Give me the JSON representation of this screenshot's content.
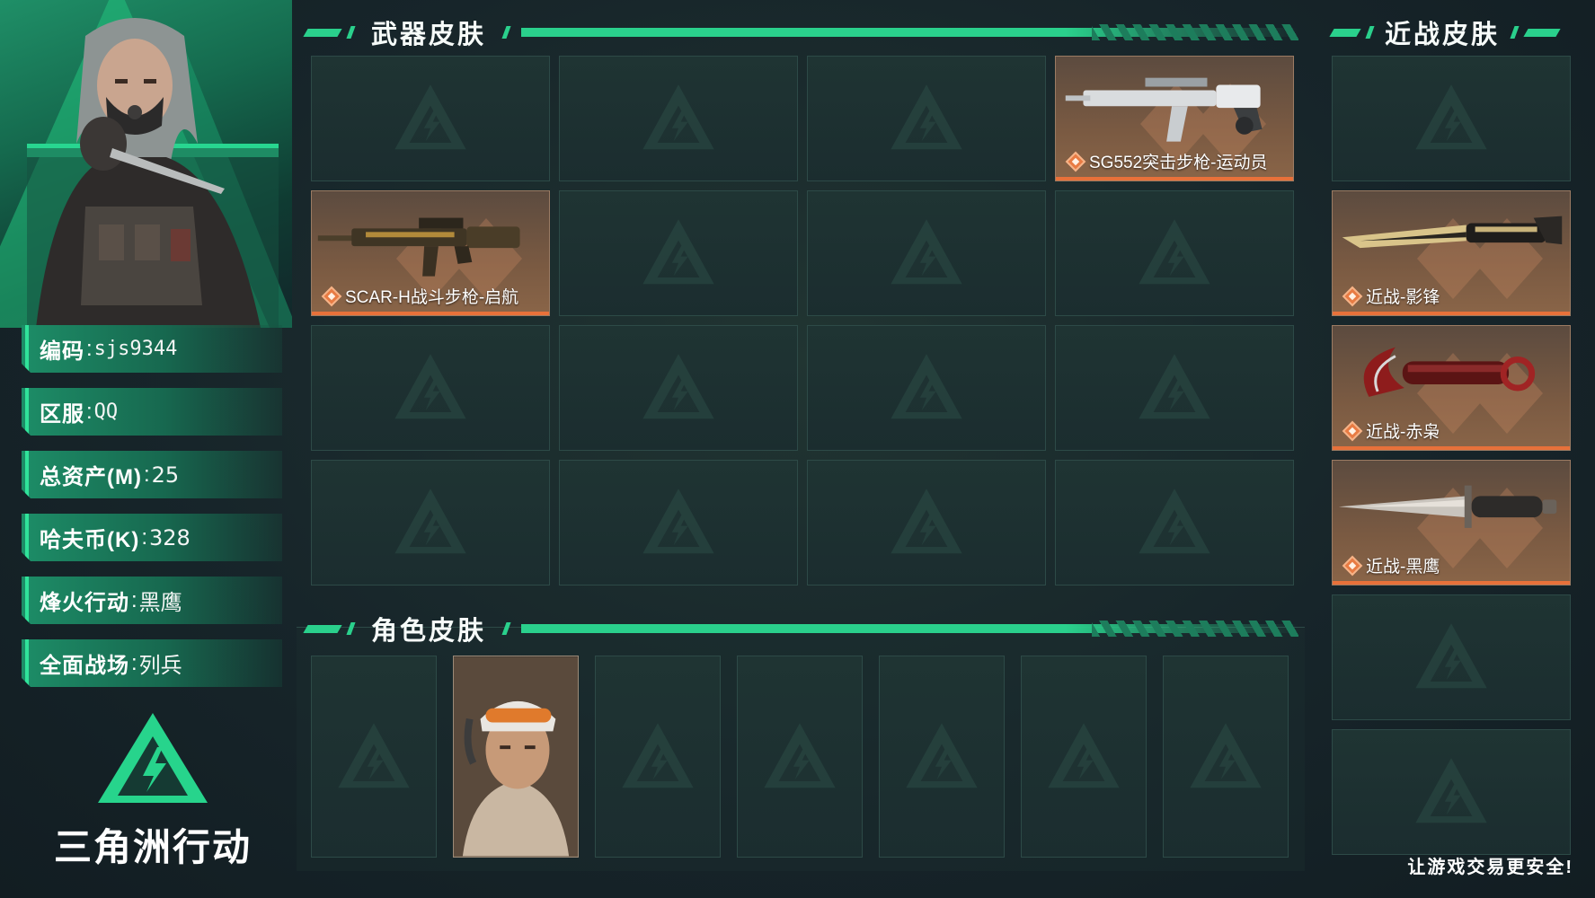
{
  "profile": {
    "rows": [
      {
        "key": "编码",
        "value": "sjs9344",
        "mono": true
      },
      {
        "key": "区服",
        "value": "QQ",
        "mono": true
      },
      {
        "key": "总资产(M)",
        "value": "25",
        "mono": false
      },
      {
        "key": "哈夫币(K)",
        "value": "328",
        "mono": false
      },
      {
        "key": "烽火行动",
        "value": "黑鹰",
        "mono": false
      },
      {
        "key": "全面战场",
        "value": "列兵",
        "mono": false
      }
    ],
    "separator": ":"
  },
  "logo": {
    "text": "三角洲行动"
  },
  "weapon_section": {
    "title": "武器皮肤",
    "slots": [
      {
        "label": ""
      },
      {
        "label": ""
      },
      {
        "label": ""
      },
      {
        "label": "SG552突击步枪-运动员",
        "art": "rifle-white"
      },
      {
        "label": "SCAR-H战斗步枪-启航",
        "art": "rifle-gold"
      },
      {
        "label": ""
      },
      {
        "label": ""
      },
      {
        "label": ""
      },
      {
        "label": ""
      },
      {
        "label": ""
      },
      {
        "label": ""
      },
      {
        "label": ""
      },
      {
        "label": ""
      },
      {
        "label": ""
      },
      {
        "label": ""
      },
      {
        "label": ""
      }
    ]
  },
  "melee_section": {
    "title": "近战皮肤",
    "slots": [
      {
        "label": ""
      },
      {
        "label": "近战-影锋",
        "art": "blade-gold"
      },
      {
        "label": "近战-赤枭",
        "art": "karambit-red"
      },
      {
        "label": "近战-黑鹰",
        "art": "knife-steel"
      },
      {
        "label": ""
      },
      {
        "label": ""
      }
    ]
  },
  "character_section": {
    "title": "角色皮肤",
    "slots": [
      {
        "filled": false
      },
      {
        "filled": true
      },
      {
        "filled": false
      },
      {
        "filled": false
      },
      {
        "filled": false
      },
      {
        "filled": false
      },
      {
        "filled": false
      }
    ]
  },
  "footer": {
    "note": "让游戏交易更安全!"
  },
  "colors": {
    "accent": "#2ad08c",
    "rarity_orange": "#e8713a",
    "slot_bg": "#1f3433"
  }
}
